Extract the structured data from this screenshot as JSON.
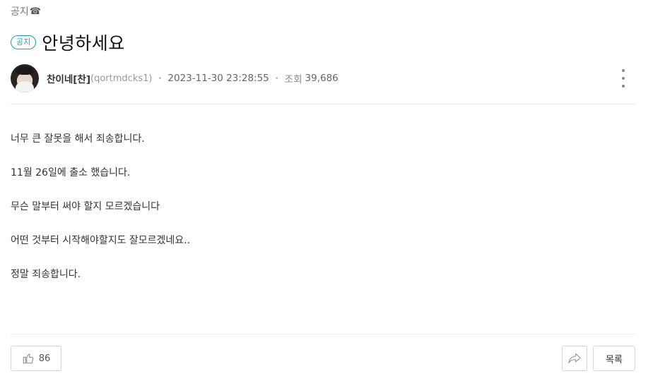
{
  "breadcrumb": {
    "label": "공지",
    "icon": "phone-icon",
    "icon_glyph": "☎"
  },
  "post": {
    "badge": "공지",
    "title": "안녕하세요",
    "author": {
      "nickname": "찬이네[찬]",
      "user_id": "(qortmdcks1)"
    },
    "date": "2023-11-30 23:28:55",
    "views_label": "조회",
    "views": "39,686",
    "body": [
      "너무 큰 잘못을 해서 죄송합니다.",
      "11월 26일에 출소 했습니다.",
      "무슨 말부터 써야 할지 모르겠습니다",
      "어떤 것부터 시작해야할지도 잘모르겠네요..",
      "정말 죄송합니다."
    ]
  },
  "actions": {
    "like_count": "86",
    "like_icon": "thumbs-up-icon",
    "share_icon": "share-icon",
    "list_label": "목록"
  },
  "colors": {
    "accent": "#1aa0b8",
    "divider": "#ececec",
    "border": "#d6d6d6"
  }
}
